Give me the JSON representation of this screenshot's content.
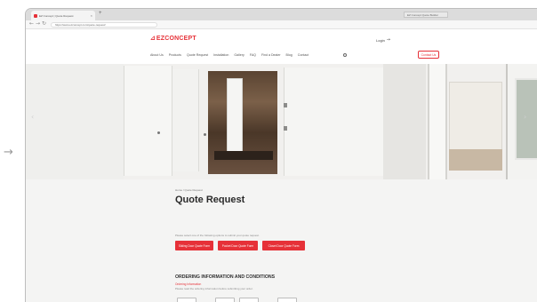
{
  "browser": {
    "tab_title": "EZ Concept | Quote Request",
    "tab_close": "×",
    "new_tab": "+",
    "extension_window": "EZ Concept Quote Builder",
    "url": "https://www.ezconcept.com/quote-request/",
    "nav_back": "←",
    "nav_forward": "→",
    "nav_reload": "↻"
  },
  "header": {
    "logo_mark": "⊿",
    "logo_text": "EZCONCEPT",
    "right_link": "Login",
    "right_arrow": "→",
    "nav": [
      "About Us",
      "Products",
      "Quote Request",
      "Installation",
      "Gallery",
      "FAQ",
      "Find a Dealer",
      "Blog",
      "Contact"
    ],
    "cta_label": "Contact Us"
  },
  "hero": {
    "prev_arrow": "‹",
    "next_arrow": "›"
  },
  "content": {
    "breadcrumb": "Home / Quote Request",
    "title": "Quote Request",
    "intro": "Please select one of the following options to submit your quote request.",
    "actions": [
      {
        "label": "Sliding Door Quote Form"
      },
      {
        "label": "Pocket Door Quote Form"
      },
      {
        "label": "Closet Door Quote Form"
      }
    ],
    "section_heading": "ORDERING INFORMATION AND CONDITIONS",
    "section_sub": "Ordering Information",
    "section_desc": "Please read the ordering information before submitting your order."
  },
  "page_glyph": "→",
  "colors": {
    "brand_red": "#e63138",
    "content_bg": "#f4f4f3",
    "text_dark": "#2a2a2a"
  }
}
